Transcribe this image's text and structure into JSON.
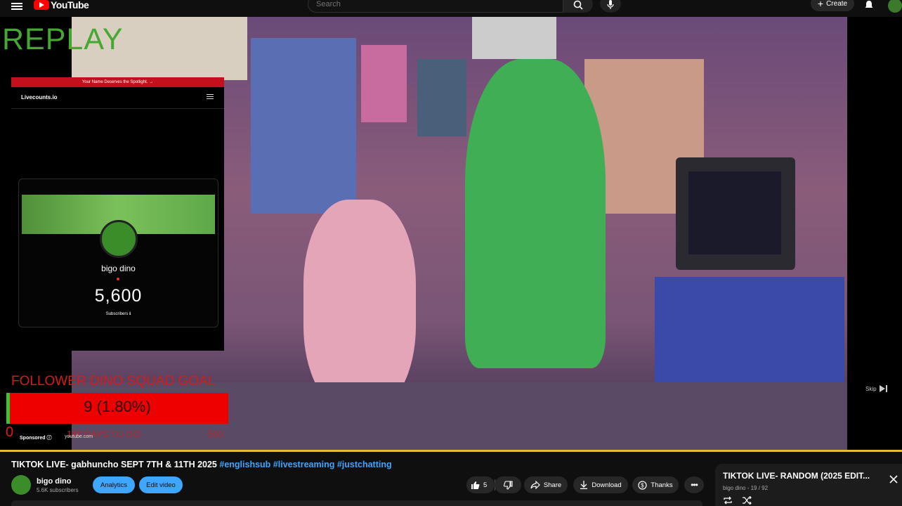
{
  "header": {
    "brand": "YouTube",
    "search_placeholder": "Search",
    "create_label": "Create"
  },
  "overlay": {
    "replay_text": "REPLAY",
    "counts_banner": "Your Name Deserves the Spotlight. →",
    "counts_site": "Livecounts.io",
    "counts_channel": "bigo dino",
    "counts_value": "5,600",
    "counts_label": "Subscribers ℹ",
    "goal_title": "FOLLOWER DINO SQUAD GOAL",
    "goal_progress_text": "9 (1.80%)",
    "goal_start": "0",
    "goal_days": "180 DAYS TO GO",
    "goal_end": "500",
    "goal_progress_fraction": 0.018
  },
  "ad": {
    "sponsored": "Sponsored",
    "url": "youtube.com",
    "skip": "Skip"
  },
  "video": {
    "title": "TIKTOK LIVE- gabhuncho SEPT 7TH & 11TH 2025",
    "hashtags": [
      "#englishsub",
      "#livestreaming",
      "#justchatting"
    ],
    "channel": "bigo dino",
    "subs": "5.6K subscribers"
  },
  "actions": {
    "analytics": "Analytics",
    "edit": "Edit video",
    "likes": "5",
    "share": "Share",
    "download": "Download",
    "thanks": "Thanks"
  },
  "playlist": {
    "title": "TIKTOK LIVE- RANDOM (2025 EDIT...",
    "sub": "bigo dino - 19 / 92"
  },
  "colors": {
    "accent_blue": "#3ea6ff",
    "replay_green": "#46a832",
    "goal_red": "#e00000",
    "progress_gold": "#e8b83a"
  }
}
